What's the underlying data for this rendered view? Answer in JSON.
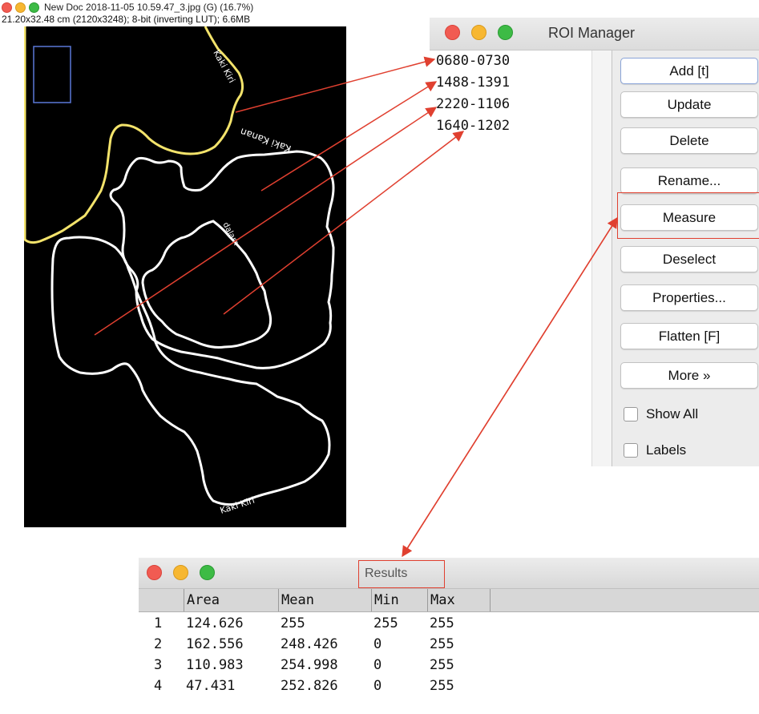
{
  "image_window": {
    "title": "New Doc 2018-11-05 10.59.47_3.jpg (G) (16.7%)",
    "info": "21.20x32.48 cm (2120x3248); 8-bit (inverting LUT); 6.6MB",
    "annotations": [
      "Kaki Kiri",
      "Kaki Kanan",
      "dalam",
      "Kaki Kiri"
    ]
  },
  "roi_manager": {
    "title": "ROI Manager",
    "rois": [
      "0680-0730",
      "1488-1391",
      "2220-1106",
      "1640-1202"
    ],
    "buttons": [
      "Add [t]",
      "Update",
      "Delete",
      "Rename...",
      "Measure",
      "Deselect",
      "Properties...",
      "Flatten [F]",
      "More »"
    ],
    "checkboxes": [
      {
        "label": "Show All",
        "checked": false
      },
      {
        "label": "Labels",
        "checked": false
      }
    ]
  },
  "results": {
    "title": "Results",
    "columns": [
      "",
      "Area",
      "Mean",
      "Min",
      "Max"
    ],
    "rows": [
      [
        "1",
        "124.626",
        "255",
        "255",
        "255"
      ],
      [
        "2",
        "162.556",
        "248.426",
        "0",
        "255"
      ],
      [
        "3",
        "110.983",
        "254.998",
        "0",
        "255"
      ],
      [
        "4",
        "47.431",
        "252.826",
        "0",
        "255"
      ]
    ]
  },
  "colors": {
    "arrow": "#e04030",
    "yellow_outline": "#f3e36b",
    "selection_rect": "#5a78d8",
    "canvas": "#000000"
  }
}
